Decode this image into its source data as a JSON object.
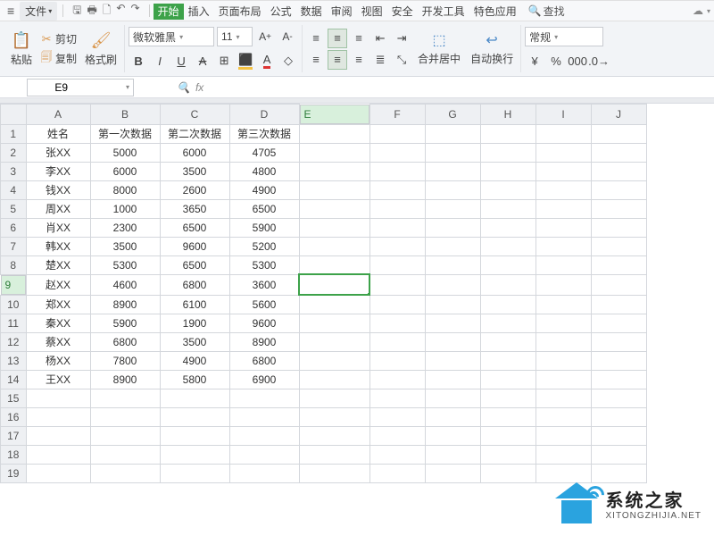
{
  "menu": {
    "file": "文件",
    "tabs": [
      "开始",
      "插入",
      "页面布局",
      "公式",
      "数据",
      "审阅",
      "视图",
      "安全",
      "开发工具",
      "特色应用"
    ],
    "active_tab": 0,
    "find": "查找"
  },
  "ribbon": {
    "paste": "粘贴",
    "cut": "剪切",
    "copy": "复制",
    "format_painter": "格式刷",
    "font_name": "微软雅黑",
    "font_size": "11",
    "merge": "合并居中",
    "wrap": "自动换行",
    "num_format": "常规"
  },
  "namebox": "E9",
  "columns": [
    "A",
    "B",
    "C",
    "D",
    "E",
    "F",
    "G",
    "H",
    "I",
    "J"
  ],
  "row_count": 19,
  "selected": {
    "col": "E",
    "row": 9
  },
  "headers": {
    "A": "姓名",
    "B": "第一次数据",
    "C": "第二次数据",
    "D": "第三次数据"
  },
  "chart_data": {
    "type": "table",
    "columns": [
      "姓名",
      "第一次数据",
      "第二次数据",
      "第三次数据"
    ],
    "rows": [
      [
        "张XX",
        5000,
        6000,
        4705
      ],
      [
        "李XX",
        6000,
        3500,
        4800
      ],
      [
        "钱XX",
        8000,
        2600,
        4900
      ],
      [
        "周XX",
        1000,
        3650,
        6500
      ],
      [
        "肖XX",
        2300,
        6500,
        5900
      ],
      [
        "韩XX",
        3500,
        9600,
        5200
      ],
      [
        "楚XX",
        5300,
        6500,
        5300
      ],
      [
        "赵XX",
        4600,
        6800,
        3600
      ],
      [
        "郑XX",
        8900,
        6100,
        5600
      ],
      [
        "秦XX",
        5900,
        1900,
        9600
      ],
      [
        "蔡XX",
        6800,
        3500,
        8900
      ],
      [
        "杨XX",
        7800,
        4900,
        6800
      ],
      [
        "王XX",
        8900,
        5800,
        6900
      ]
    ]
  },
  "watermark": {
    "cn": "系统之家",
    "en": "XITONGZHIJIA.NET"
  }
}
